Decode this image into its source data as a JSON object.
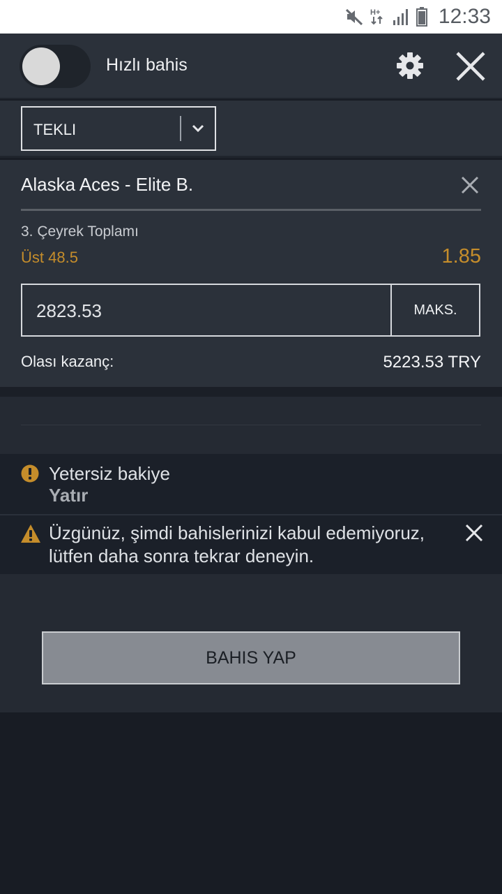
{
  "status_bar": {
    "time": "12:33",
    "icons": [
      "mute-icon",
      "hplus-network-icon",
      "signal-icon",
      "battery-icon"
    ]
  },
  "header": {
    "quick_bet_label": "Hızlı bahis",
    "quick_bet_enabled": false
  },
  "bet_type": {
    "selected": "TEKLI"
  },
  "bet": {
    "event": "Alaska Aces - Elite B.",
    "market": "3. Çeyrek Toplamı",
    "selection": "Üst 48.5",
    "odds": "1.85",
    "stake": "2823.53",
    "max_label": "MAKS.",
    "potential_win_label": "Olası kazanç:",
    "potential_win_value": "5223.53 TRY"
  },
  "alerts": {
    "insufficient_balance": "Yetersiz bakiye",
    "deposit_link": "Yatır",
    "error_message": "Üzgünüz, şimdi bahislerinizi kabul edemiyoruz, lütfen daha sonra tekrar deneyin."
  },
  "footer": {
    "place_bet_label": "BAHIS YAP"
  },
  "colors": {
    "accent": "#c58d2b",
    "panel": "#2b313a",
    "background": "#181c24"
  }
}
